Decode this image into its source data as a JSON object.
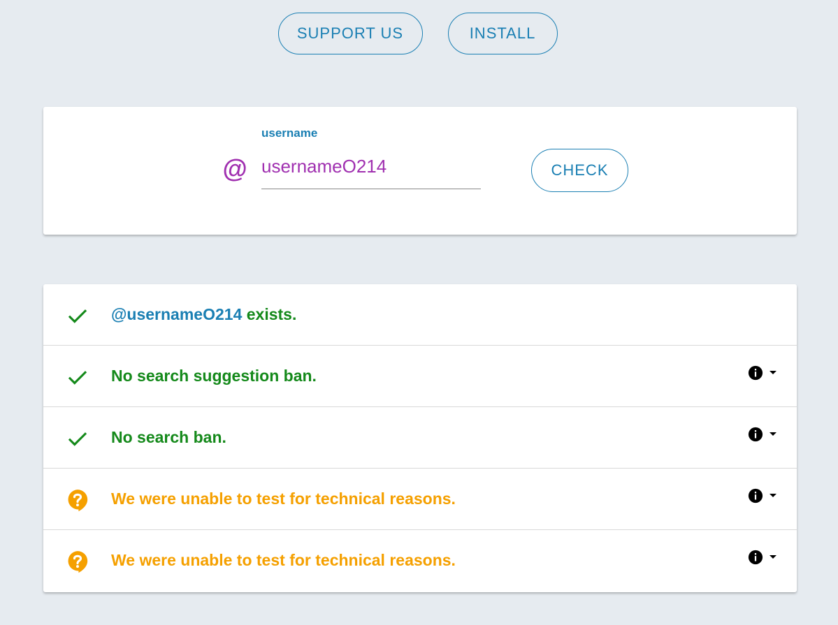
{
  "header": {
    "support_label": "SUPPORT US",
    "install_label": "INSTALL"
  },
  "search": {
    "at_symbol": "@",
    "label": "username",
    "value": "usernameO214",
    "check_label": "CHECK"
  },
  "results": [
    {
      "status": "ok",
      "icon": "checkmark-icon",
      "handle": "@usernameO214",
      "text": " exists.",
      "has_info": false
    },
    {
      "status": "ok",
      "icon": "checkmark-icon",
      "text": "No search suggestion ban.",
      "has_info": true
    },
    {
      "status": "ok",
      "icon": "checkmark-icon",
      "text": "No search ban.",
      "has_info": true
    },
    {
      "status": "unknown",
      "icon": "question-bubble-icon",
      "text": "We were unable to test for technical reasons.",
      "has_info": true
    },
    {
      "status": "unknown",
      "icon": "question-bubble-icon",
      "text": "We were unable to test for technical reasons.",
      "has_info": true
    }
  ],
  "colors": {
    "background": "#e6ebf0",
    "accent_blue": "#1a7fb3",
    "username_purple": "#a030b0",
    "success_green": "#14891a",
    "warning_orange": "#f5a000"
  }
}
